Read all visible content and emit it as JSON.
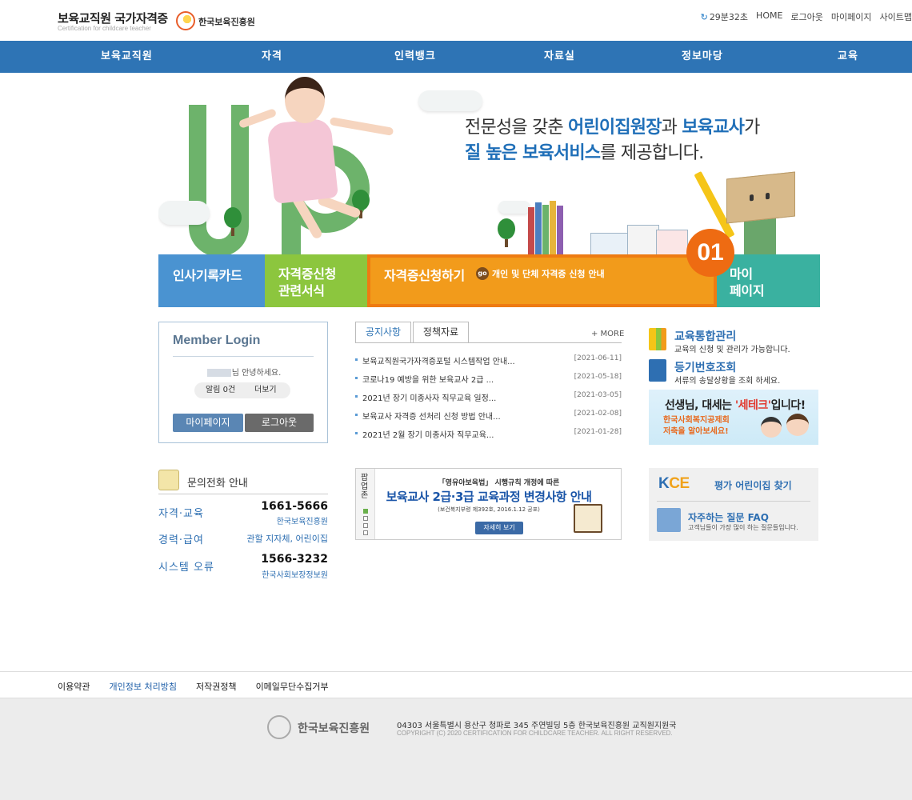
{
  "header": {
    "logo_title": "보육교직원 국가자격증",
    "logo_subtitle": "Certification for childcare teacher",
    "org_logo_text": "한국보육진흥원",
    "org_logo_mark": "KCPI",
    "timer": "29분32초",
    "util_links": [
      "HOME",
      "로그아웃",
      "마이페이지",
      "사이트맵"
    ]
  },
  "gnb": [
    "보육교직원",
    "자격",
    "인력뱅크",
    "자료실",
    "정보마당",
    "교육"
  ],
  "visual": {
    "line1": {
      "a": "전문성을 갖춘 ",
      "b": "어린이집원장",
      "c": "과 ",
      "d": "보육교사",
      "e": "가"
    },
    "line2": {
      "a": "질 높은 보육서비스",
      "b": "를 제공합니다."
    }
  },
  "quick_menu": {
    "item1": "인사기록카드",
    "item2_l1": "자격증신청",
    "item2_l2": "관련서식",
    "item3": "자격증신청하기",
    "item3_go": "go",
    "item3_desc": "개인 및 단체 자격증 신청 안내",
    "item4_l1": "마이",
    "item4_l2": "페이지",
    "badge": "01"
  },
  "login": {
    "title": "Member Login",
    "greet": "님 안녕하세요.",
    "notice": "알림 0건",
    "more": "더보기",
    "mypage_btn": "마이페이지",
    "logout_btn": "로그아웃"
  },
  "contact": {
    "title": "문의전화 안내",
    "rows": [
      {
        "label": "자격·교육",
        "number": "1661-5666",
        "org": "한국보육진흥원"
      },
      {
        "label": "경력·급여",
        "number": "",
        "org": "관할 지자체, 어린이집"
      },
      {
        "label": "시스템 오류",
        "number": "1566-3232",
        "org": "한국사회보장정보원"
      }
    ]
  },
  "board": {
    "tabs": [
      "공지사항",
      "정책자료"
    ],
    "more": "+ MORE",
    "rows": [
      {
        "title": "보육교직원국가자격증포털 시스템작업 안내...",
        "date": "[2021-06-11]"
      },
      {
        "title": "코로나19 예방을 위한 보육교사 2급 ...",
        "date": "[2021-05-18]"
      },
      {
        "title": "2021년 장기 미종사자 직무교육 일정...",
        "date": "[2021-03-05]"
      },
      {
        "title": "보육교사 자격증 선처리 신청 방법 안내...",
        "date": "[2021-02-08]"
      },
      {
        "title": "2021년 2월 장기 미종사자 직무교육...",
        "date": "[2021-01-28]"
      }
    ]
  },
  "popup_zone": {
    "label": "팝업존",
    "l1": "「영유아보육법」 시행규칙 개정에 따른",
    "l2": "보육교사 2급·3급 교육과정 변경사항 안내",
    "l3": "(보건복지부령 제392호, 2016.1.12 공포)",
    "button": "자세히 보기"
  },
  "right": {
    "edu_title": "교육통합관리",
    "edu_sub": "교육의 신청 및 관리가 가능합니다.",
    "reg_title": "등기번호조회",
    "reg_sub": "서류의 송달상황을 조회 하세요.",
    "setec_l1a": "선생님, 대세는 ",
    "setec_l1b": "'세테크'",
    "setec_l1c": "입니다!",
    "setec_l2": "한국사회복지공제회",
    "setec_l3": "저축을 알아보세요!",
    "kce_logo_k": "K",
    "kce_logo_rest": "CE",
    "kce_title": "평가 어린이집 찾기",
    "faq_title": "자주하는 질문 FAQ",
    "faq_sub": "고객님들이 가장 많이 하는 질문들입니다."
  },
  "footer": {
    "links": [
      "이용약관",
      "개인정보 처리방침",
      "저작권정책",
      "이메일무단수집거부"
    ],
    "logo_text": "한국보육진흥원",
    "logo_mark": "KCPI",
    "address": "04303 서울특별시 용산구 청파로 345 주연빌딩 5층 한국보육진흥원 교직원지원국",
    "copyright": "COPYRIGHT (C) 2020 CERTIFICATION FOR CHILDCARE TEACHER. ALL RIGHT RESERVED."
  },
  "colors": {
    "nav_blue": "#2e74b5",
    "accent_blue": "#1f6fb8",
    "orange": "#f29b1b",
    "green": "#8cc63e",
    "teal": "#3ab1a0"
  }
}
